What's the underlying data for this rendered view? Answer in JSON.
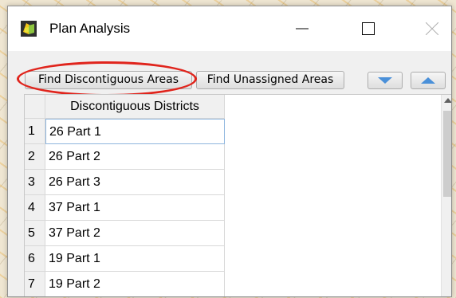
{
  "window": {
    "title": "Plan Analysis",
    "app_icon": "app-logo-icon",
    "controls": {
      "minimize_icon": "minimize-icon",
      "maximize_icon": "maximize-icon",
      "close_icon": "close-icon"
    }
  },
  "toolbar": {
    "find_discontiguous_label": "Find Discontiguous Areas",
    "find_unassigned_label": "Find Unassigned Areas",
    "move_down_icon": "triangle-down-icon",
    "move_up_icon": "triangle-up-icon",
    "highlight_color": "#e0241c",
    "arrow_color": "#4a90d9"
  },
  "table": {
    "column_header": "Discontiguous Districts",
    "rows": [
      {
        "num": "1",
        "value": "26 Part 1"
      },
      {
        "num": "2",
        "value": "26 Part 2"
      },
      {
        "num": "3",
        "value": "26 Part 3"
      },
      {
        "num": "4",
        "value": "37 Part 1"
      },
      {
        "num": "5",
        "value": "37 Part 2"
      },
      {
        "num": "6",
        "value": "19 Part 1"
      },
      {
        "num": "7",
        "value": "19 Part 2"
      }
    ],
    "selected_row": 1
  }
}
